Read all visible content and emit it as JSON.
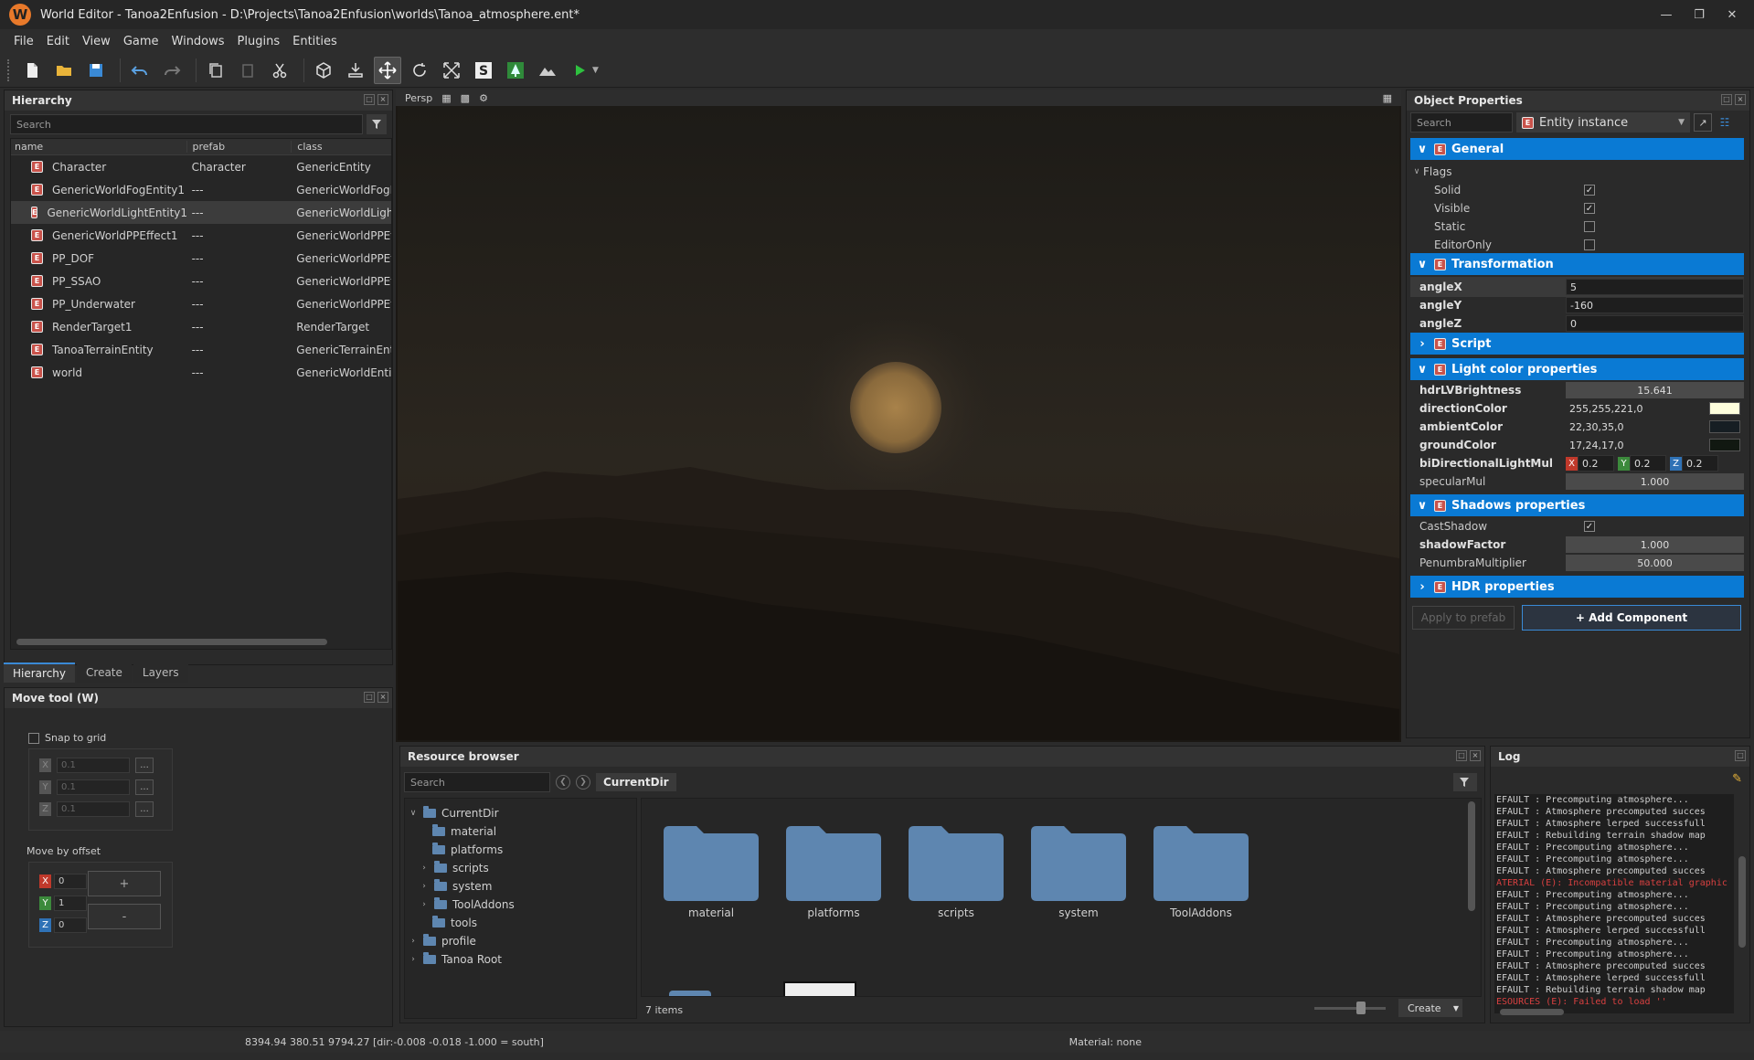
{
  "window": {
    "title": "World Editor - Tanoa2Enfusion - D:\\Projects\\Tanoa2Enfusion\\worlds\\Tanoa_atmosphere.ent*",
    "logo_letter": "W"
  },
  "menu": [
    "File",
    "Edit",
    "View",
    "Game",
    "Windows",
    "Plugins",
    "Entities"
  ],
  "hierarchy": {
    "title": "Hierarchy",
    "search_placeholder": "Search",
    "columns": [
      "name",
      "prefab",
      "class"
    ],
    "rows": [
      {
        "name": "Character",
        "prefab": "Character",
        "class": "GenericEntity"
      },
      {
        "name": "GenericWorldFogEntity1",
        "prefab": "---",
        "class": "GenericWorldFogEn"
      },
      {
        "name": "GenericWorldLightEntity1",
        "prefab": "---",
        "class": "GenericWorldLightE"
      },
      {
        "name": "GenericWorldPPEffect1",
        "prefab": "---",
        "class": "GenericWorldPPEffe"
      },
      {
        "name": "PP_DOF",
        "prefab": "---",
        "class": "GenericWorldPPEffe"
      },
      {
        "name": "PP_SSAO",
        "prefab": "---",
        "class": "GenericWorldPPEffe"
      },
      {
        "name": "PP_Underwater",
        "prefab": "---",
        "class": "GenericWorldPPEffe"
      },
      {
        "name": "RenderTarget1",
        "prefab": "---",
        "class": "RenderTarget"
      },
      {
        "name": "TanoaTerrainEntity",
        "prefab": "---",
        "class": "GenericTerrainEntity"
      },
      {
        "name": "world",
        "prefab": "---",
        "class": "GenericWorldEntity"
      }
    ],
    "tabs": [
      "Hierarchy",
      "Create",
      "Layers"
    ]
  },
  "move_tool": {
    "title": "Move tool (W)",
    "snap_label": "Snap to grid",
    "snap_values": {
      "x": "0.1",
      "y": "0.1",
      "z": "0.1"
    },
    "move_by_offset_label": "Move by offset",
    "offset_values": {
      "x": "0",
      "y": "1",
      "z": "0"
    },
    "plus": "+",
    "minus": "-",
    "dots": "..."
  },
  "viewport": {
    "mode": "Persp"
  },
  "object_properties": {
    "title": "Object Properties",
    "search_placeholder": "Search",
    "entity_type": "Entity instance",
    "general": "General",
    "flags": "Flags",
    "flag_items": [
      {
        "label": "Solid",
        "checked": "✓"
      },
      {
        "label": "Visible",
        "checked": "✓"
      },
      {
        "label": "Static",
        "checked": ""
      },
      {
        "label": "EditorOnly",
        "checked": ""
      }
    ],
    "transformation": "Transformation",
    "angles": [
      {
        "label": "angleX",
        "value": "5"
      },
      {
        "label": "angleY",
        "value": "-160"
      },
      {
        "label": "angleZ",
        "value": "0"
      }
    ],
    "script": "Script",
    "light_color": "Light color properties",
    "hdr_brightness": {
      "label": "hdrLVBrightness",
      "value": "15.641"
    },
    "direction_color": {
      "label": "directionColor",
      "value": "255,255,221,0",
      "swatch": "#ffffdd"
    },
    "ambient_color": {
      "label": "ambientColor",
      "value": "22,30,35,0",
      "swatch": "#161e23"
    },
    "ground_color": {
      "label": "groundColor",
      "value": "17,24,17,0",
      "swatch": "#111811"
    },
    "bidir": {
      "label": "biDirectionalLightMul",
      "x": "0.2",
      "y": "0.2",
      "z": "0.2"
    },
    "specular": {
      "label": "specularMul",
      "value": "1.000"
    },
    "shadows": "Shadows properties",
    "cast_shadow": {
      "label": "CastShadow",
      "checked": "✓"
    },
    "shadow_factor": {
      "label": "shadowFactor",
      "value": "1.000"
    },
    "penumbra": {
      "label": "PenumbraMultiplier",
      "value": "50.000"
    },
    "hdr": "HDR properties",
    "apply_prefab": "Apply to prefab",
    "add_component": "+ Add Component"
  },
  "resource_browser": {
    "title": "Resource browser",
    "search_placeholder": "Search",
    "current_dir": "CurrentDir",
    "tree": {
      "root": "CurrentDir",
      "children": [
        "material",
        "platforms",
        "scripts",
        "system",
        "ToolAddons",
        "tools"
      ],
      "others": [
        "profile",
        "Tanoa Root"
      ]
    },
    "folders": [
      "material",
      "platforms",
      "scripts",
      "system",
      "ToolAddons"
    ],
    "items_count": "7 items",
    "create_label": "Create"
  },
  "log": {
    "title": "Log",
    "lines": [
      {
        "t": "EFAULT     : Precomputing atmosphere...",
        "err": false
      },
      {
        "t": "EFAULT     : Atmosphere precomputed succes",
        "err": false
      },
      {
        "t": "EFAULT     : Atmosphere lerped successfull",
        "err": false
      },
      {
        "t": "EFAULT     : Rebuilding terrain shadow map",
        "err": false
      },
      {
        "t": "EFAULT     : Precomputing atmosphere...",
        "err": false
      },
      {
        "t": "EFAULT     : Precomputing atmosphere...",
        "err": false
      },
      {
        "t": "EFAULT     : Atmosphere precomputed succes",
        "err": false
      },
      {
        "t": "ATERIAL  (E): Incompatible material graphic",
        "err": true
      },
      {
        "t": "EFAULT     : Precomputing atmosphere...",
        "err": false
      },
      {
        "t": "EFAULT     : Precomputing atmosphere...",
        "err": false
      },
      {
        "t": "EFAULT     : Atmosphere precomputed succes",
        "err": false
      },
      {
        "t": "EFAULT     : Atmosphere lerped successfull",
        "err": false
      },
      {
        "t": "EFAULT     : Precomputing atmosphere...",
        "err": false
      },
      {
        "t": "EFAULT     : Precomputing atmosphere...",
        "err": false
      },
      {
        "t": "EFAULT     : Atmosphere precomputed succes",
        "err": false
      },
      {
        "t": "EFAULT     : Atmosphere lerped successfull",
        "err": false
      },
      {
        "t": "EFAULT     : Rebuilding terrain shadow map",
        "err": false
      },
      {
        "t": "ESOURCES (E): Failed to load ''",
        "err": true
      }
    ]
  },
  "status": {
    "coords": "8394.94    380.51   9794.27 [dir:-0.008 -0.018 -1.000 = south]",
    "material": "Material: none"
  },
  "colors": {
    "accent": "#0a7ad4",
    "entity_icon": "#c9534b",
    "folder": "#5e86b0"
  }
}
